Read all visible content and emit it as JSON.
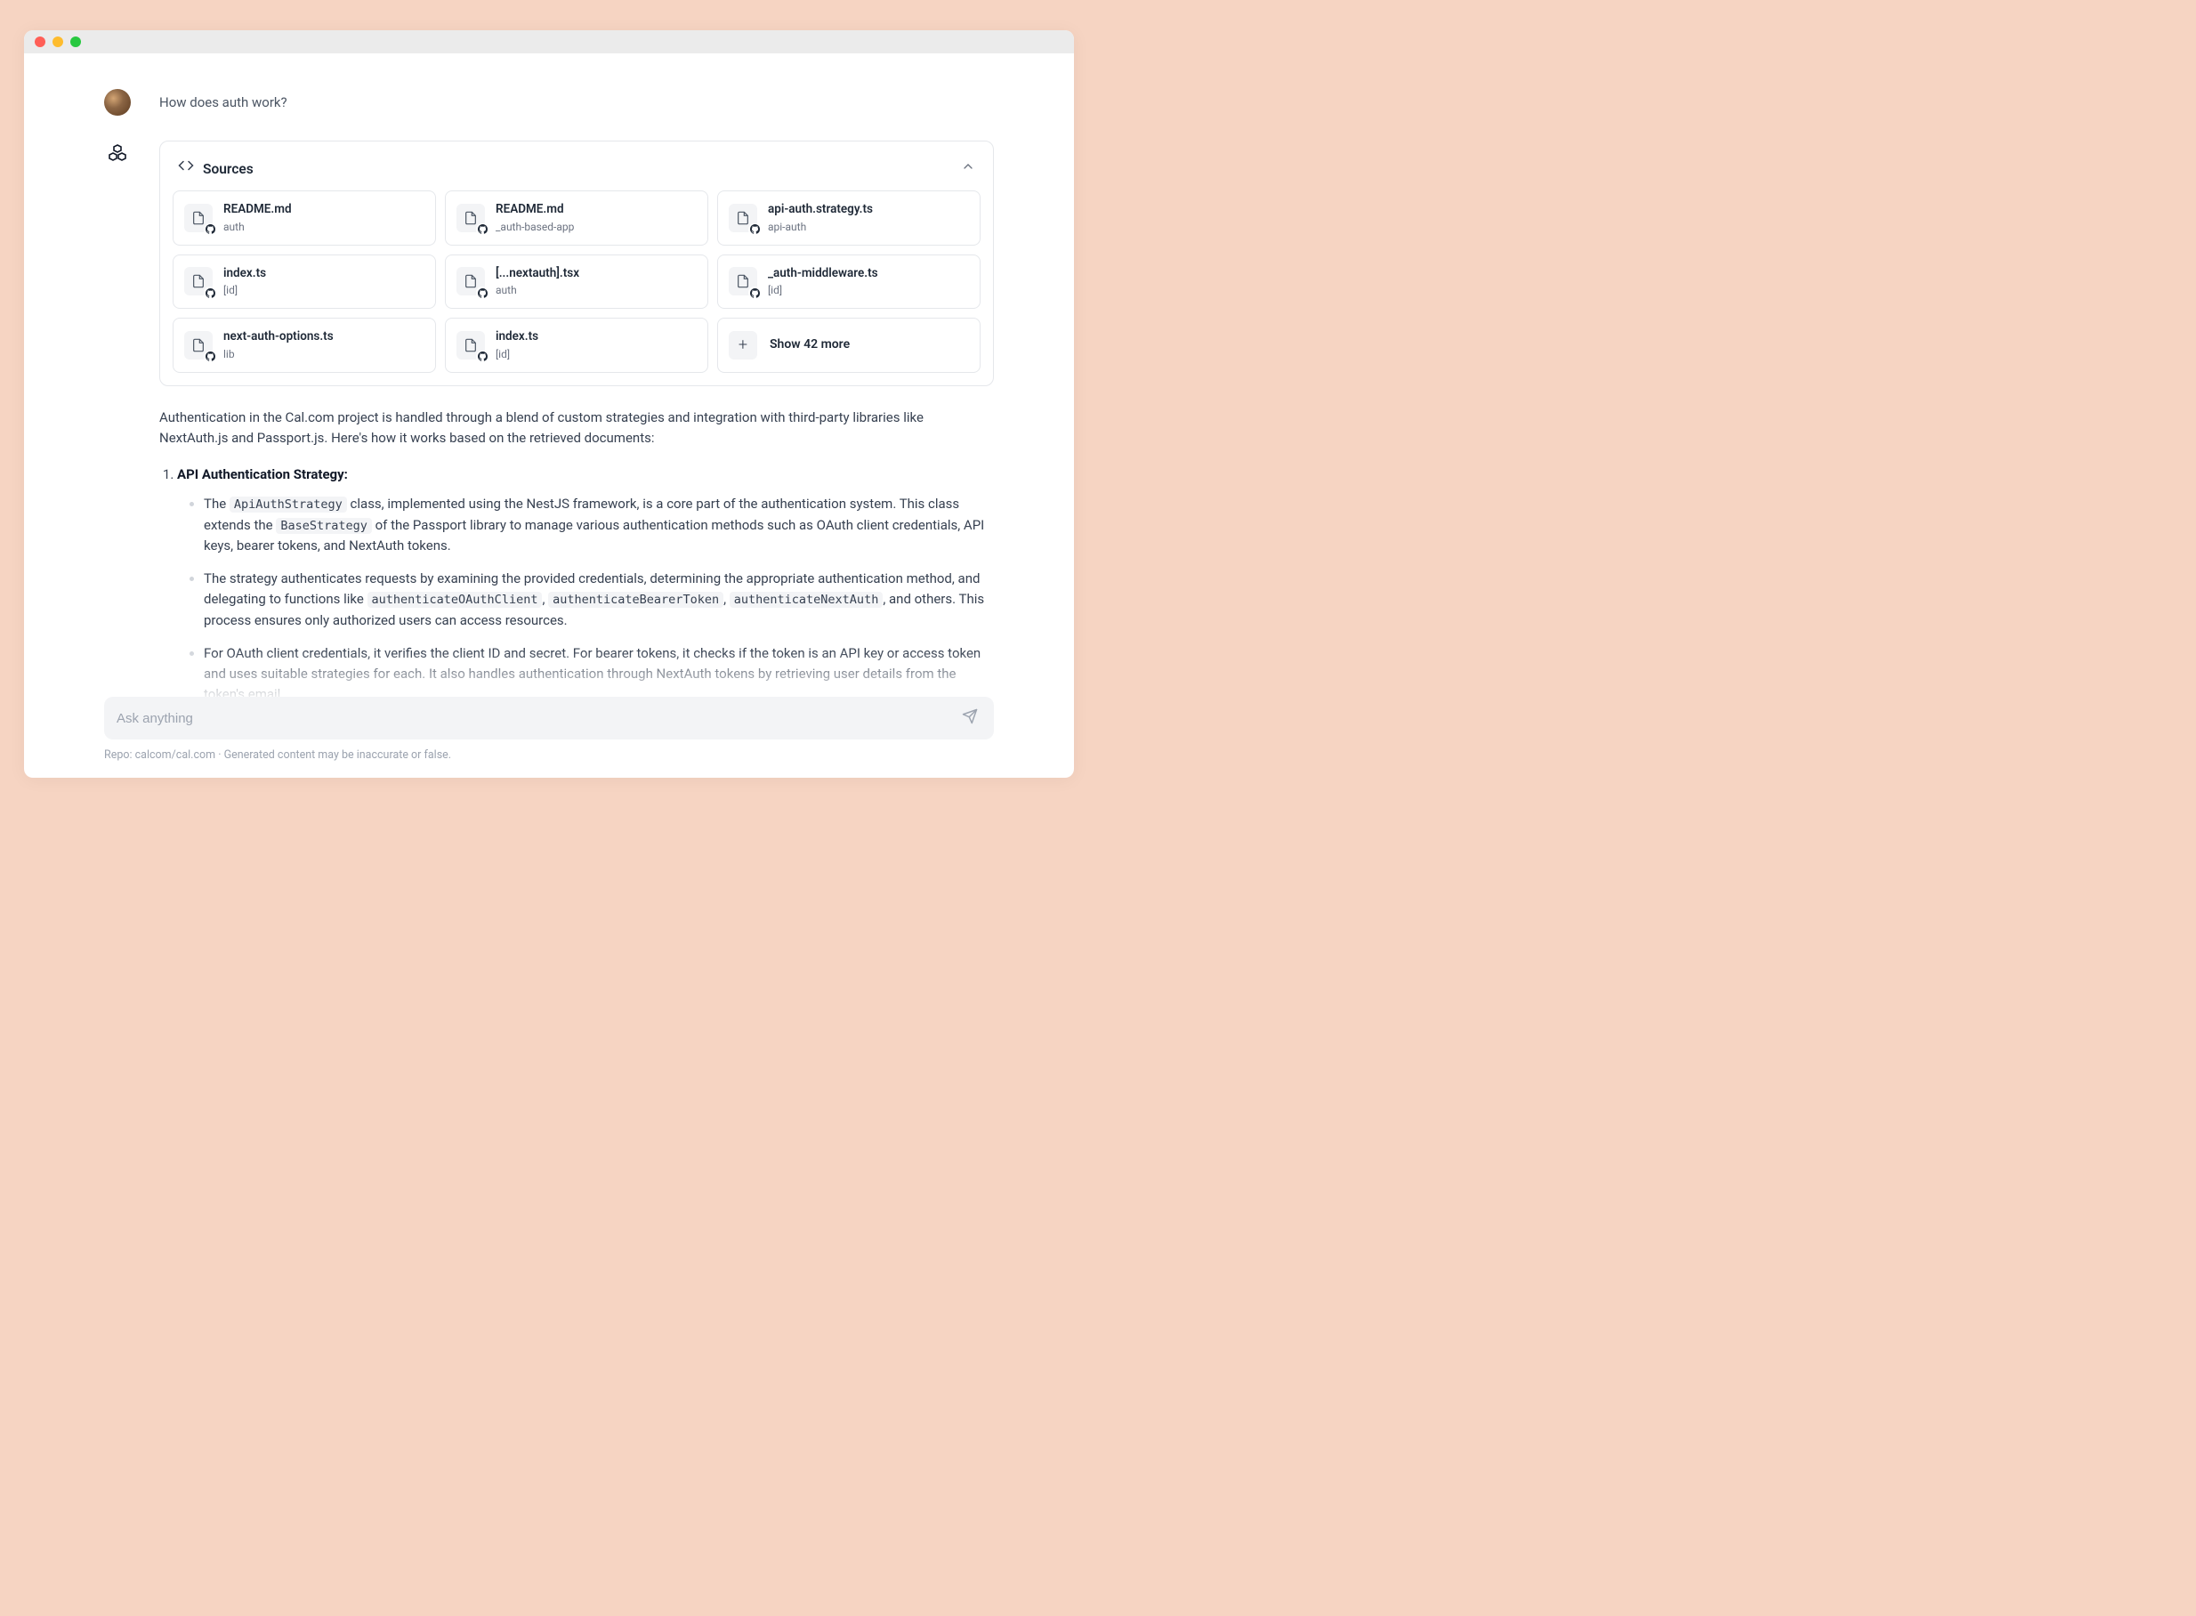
{
  "question": "How does auth work?",
  "sources": {
    "title": "Sources",
    "items": [
      {
        "name": "README.md",
        "path": "auth"
      },
      {
        "name": "README.md",
        "path": "_auth-based-app"
      },
      {
        "name": "api-auth.strategy.ts",
        "path": "api-auth"
      },
      {
        "name": "index.ts",
        "path": "[id]"
      },
      {
        "name": "[...nextauth].tsx",
        "path": "auth"
      },
      {
        "name": "_auth-middleware.ts",
        "path": "[id]"
      },
      {
        "name": "next-auth-options.ts",
        "path": "lib"
      },
      {
        "name": "index.ts",
        "path": "[id]"
      }
    ],
    "more": "Show 42 more"
  },
  "answer": {
    "intro": "Authentication in the Cal.com project is handled through a blend of custom strategies and integration with third-party libraries like NextAuth.js and Passport.js. Here's how it works based on the retrieved documents:",
    "sections": [
      {
        "heading": "API Authentication Strategy:",
        "bullets": [
          {
            "pre1": "The ",
            "code1": "ApiAuthStrategy",
            "mid1": " class, implemented using the NestJS framework, is a core part of the authentication system. This class extends the ",
            "code2": "BaseStrategy",
            "post1": " of the Passport library to manage various authentication methods such as OAuth client credentials, API keys, bearer tokens, and NextAuth tokens."
          },
          {
            "pre1": "The strategy authenticates requests by examining the provided credentials, determining the appropriate authentication method, and delegating to functions like ",
            "code1": "authenticateOAuthClient",
            "mid1": ", ",
            "code2": "authenticateBearerToken",
            "mid2": ", ",
            "code3": "authenticateNextAuth",
            "post1": ", and others. This process ensures only authorized users can access resources."
          },
          {
            "pre1": "For OAuth client credentials, it verifies the client ID and secret. For bearer tokens, it checks if the token is an API key or access token and uses suitable strategies for each. It also handles authentication through NextAuth tokens by retrieving user details from the token's email."
          }
        ]
      }
    ]
  },
  "input": {
    "placeholder": "Ask anything"
  },
  "footer": {
    "repo_prefix": "Repo: ",
    "repo": "calcom/cal.com",
    "sep": " · ",
    "disclaimer": "Generated content may be inaccurate or false."
  }
}
